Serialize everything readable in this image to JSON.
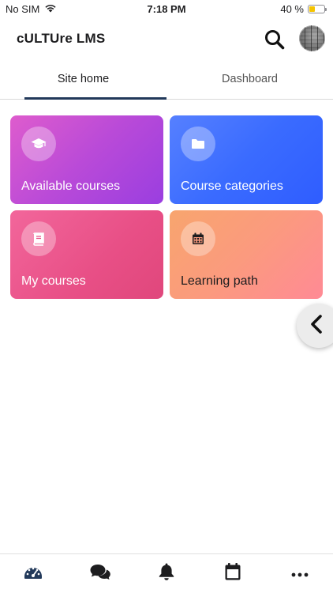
{
  "status_bar": {
    "carrier": "No SIM",
    "time": "7:18 PM",
    "battery_text": "40 %",
    "battery_level": 0.4,
    "battery_color": "#f5c400"
  },
  "header": {
    "title": "cULTUre LMS",
    "search_icon": "search-icon",
    "avatar_icon": "user-avatar"
  },
  "tabs": [
    {
      "label": "Site home",
      "active": true
    },
    {
      "label": "Dashboard",
      "active": false
    }
  ],
  "cards": [
    {
      "label": "Available courses",
      "icon": "graduation-cap-icon",
      "color": "#b94ad8"
    },
    {
      "label": "Course categories",
      "icon": "folder-icon",
      "color": "#3a6bff"
    },
    {
      "label": "My courses",
      "icon": "book-icon",
      "color": "#e84f86"
    },
    {
      "label": "Learning path",
      "icon": "calendar-icon",
      "color": "#fb9a7e"
    }
  ],
  "drawer_toggle_icon": "chevron-left-icon",
  "bottom_nav": [
    {
      "icon": "dashboard-gauge-icon",
      "active": true
    },
    {
      "icon": "messages-icon",
      "active": false
    },
    {
      "icon": "bell-icon",
      "active": false
    },
    {
      "icon": "calendar-icon",
      "active": false
    },
    {
      "icon": "more-icon",
      "active": false
    }
  ],
  "colors": {
    "nav_active": "#22395a",
    "icon_dark": "#1d1d1f"
  }
}
